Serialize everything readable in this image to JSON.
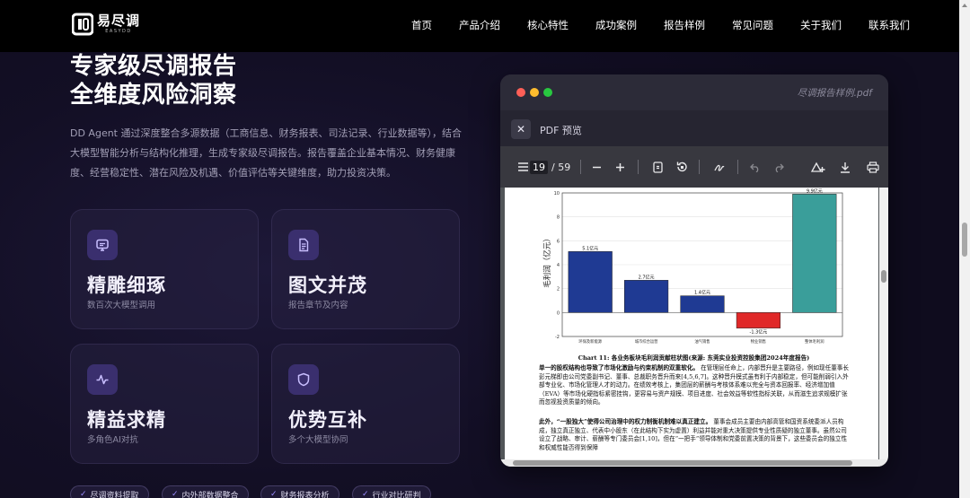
{
  "nav": {
    "logo_cn": "易尽调",
    "logo_en": "EASYDD",
    "links": [
      "首页",
      "产品介绍",
      "核心特性",
      "成功案例",
      "报告样例",
      "常见问题",
      "关于我们",
      "联系我们"
    ]
  },
  "hero": {
    "title_line1": "专家级尽调报告",
    "title_line2": "全维度风险洞察",
    "description": "DD Agent 通过深度整合多源数据（工商信息、财务报表、司法记录、行业数据等），结合大模型智能分析与结构化推理，生成专家级尽调报告。报告覆盖企业基本情况、财务健康度、经营稳定性、潜在风险及机遇、价值评估等关键维度，助力投资决策。"
  },
  "cards": [
    {
      "icon": "screen-icon",
      "title": "精雕细琢",
      "subtitle": "数百次大模型调用"
    },
    {
      "icon": "document-icon",
      "title": "图文并茂",
      "subtitle": "报告章节及内容"
    },
    {
      "icon": "pulse-icon",
      "title": "精益求精",
      "subtitle": "多角色AI对抗"
    },
    {
      "icon": "shield-icon",
      "title": "优势互补",
      "subtitle": "多个大模型协同"
    }
  ],
  "tags": [
    "尽调资料提取",
    "内外部数据整合",
    "财务报表分析",
    "行业对比研判"
  ],
  "pdf": {
    "filename": "尽调报告样例.pdf",
    "header_label": "PDF 预览",
    "current_page": "19",
    "total_pages": "/ 59",
    "chart_caption": "Chart 11: 各业务板块毛利润贡献柱状图(来源: 东莞实业投资控股集团2024年度报告)",
    "para1_bold": "单一的股权结构也导致了市场化激励与约束机制的双重软化。",
    "para1": "在管理层任命上，内部晋升是主要路径，例如现任董事长彭元梯即由公司党委副书记、董事、总裁职务晋升而来[4,5,6,7]。这种晋升模式虽有利于内部稳定，但可能削弱引入外部专业化、市场化管理人才的动力。在绩效考核上，集团层的薪酬与考核体系难以完全与资本回报率、经济增加值（EVA）等市场化硬指标紧密挂钩，更容易与资产规模、项目进度、社会效益等软性指标关联，从而滋生追求规模扩张而忽视投资质量的倾向。",
    "para2_bold": "此外，“一股独大”使得公司治理中的权力制衡机制难以真正建立。",
    "para2": "董事会成员主要由内部高管和国资系统委派人员构成，独立真正独立、代表中小股东（在此结构下实为虚置）利益并能对重大决策提供专业性质疑的独立董事。虽然公司设立了战略、审计、薪酬等专门委员会[1,10]，但在“一把手”领导体制和党委前置决策的背景下，这些委员会的独立性和权威性能否得到保障"
  },
  "chart_data": {
    "type": "bar",
    "title": "",
    "xlabel": "",
    "ylabel": "毛利润（亿元）",
    "categories": [
      "环保及新能源",
      "城市综合运营",
      "油气销售",
      "物业销售",
      "整体毛利润"
    ],
    "values": [
      5.1,
      2.7,
      1.4,
      -1.3,
      9.9
    ],
    "data_labels": [
      "5.1亿元",
      "2.7亿元",
      "1.4亿元",
      "-1.3亿元",
      "9.9亿元"
    ],
    "ylim": [
      -2,
      10
    ],
    "yticks": [
      -2,
      0,
      2,
      4,
      6,
      8,
      10
    ],
    "colors": [
      "#1f3a93",
      "#1f3a93",
      "#1f3a93",
      "#e02828",
      "#3a9e9a"
    ],
    "grid": true
  }
}
